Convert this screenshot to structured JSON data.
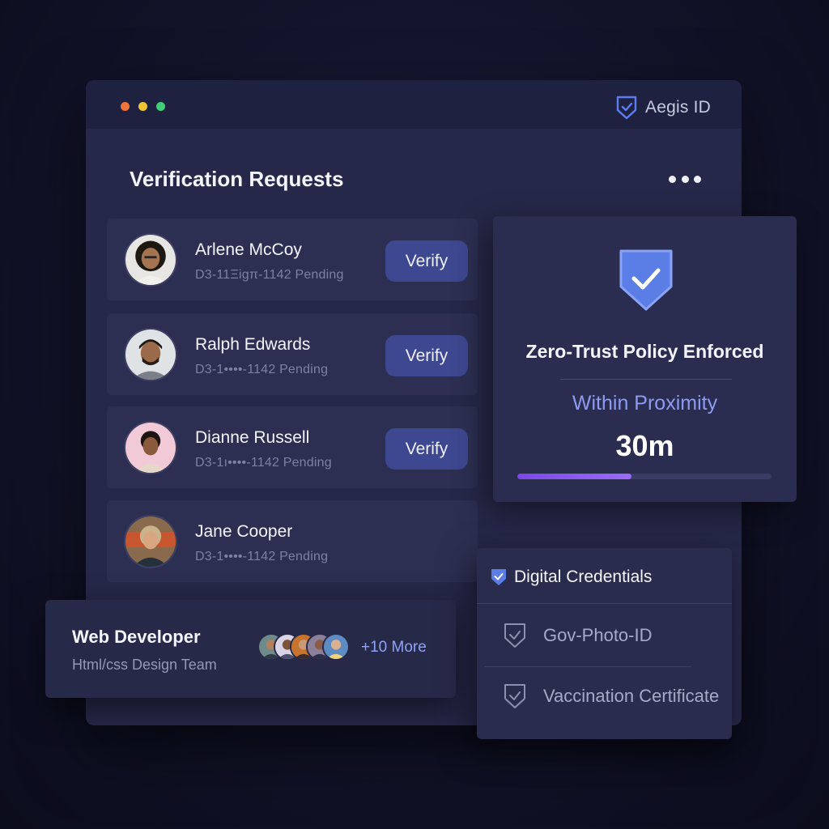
{
  "brand": {
    "name": "Aegis ID"
  },
  "requests": {
    "title": "Verification Requests",
    "items": [
      {
        "name": "Arlene McCoy",
        "status": "D3-11Ξigπ-1142 Pending",
        "action": "Verify"
      },
      {
        "name": "Ralph Edwards",
        "status": "D3-1••••-1142 Pending",
        "action": "Verify"
      },
      {
        "name": "Dianne Russell",
        "status": "D3-1ı••••-1142 Pending",
        "action": "Verify"
      },
      {
        "name": "Jane Cooper",
        "status": "D3-1••••-1142 Pending"
      }
    ]
  },
  "policy": {
    "title": "Zero-Trust Policy Enforced",
    "label": "Within Proximity",
    "value": "30m",
    "progress": 0.45
  },
  "team": {
    "title": "Web Developer",
    "subtitle": "Html/css Design Team",
    "more": "+10 More"
  },
  "credentials": {
    "title": "Digital Credentials",
    "items": [
      {
        "label": "Gov-Photo-ID"
      },
      {
        "label": "Vaccination Certificate"
      }
    ]
  },
  "colors": {
    "accent": "#3e4890",
    "progress": "#7b48e8",
    "link": "#8fa3f6"
  },
  "icons": [
    "shield-check-icon",
    "more-horizontal-icon",
    "check-shield-icon"
  ]
}
